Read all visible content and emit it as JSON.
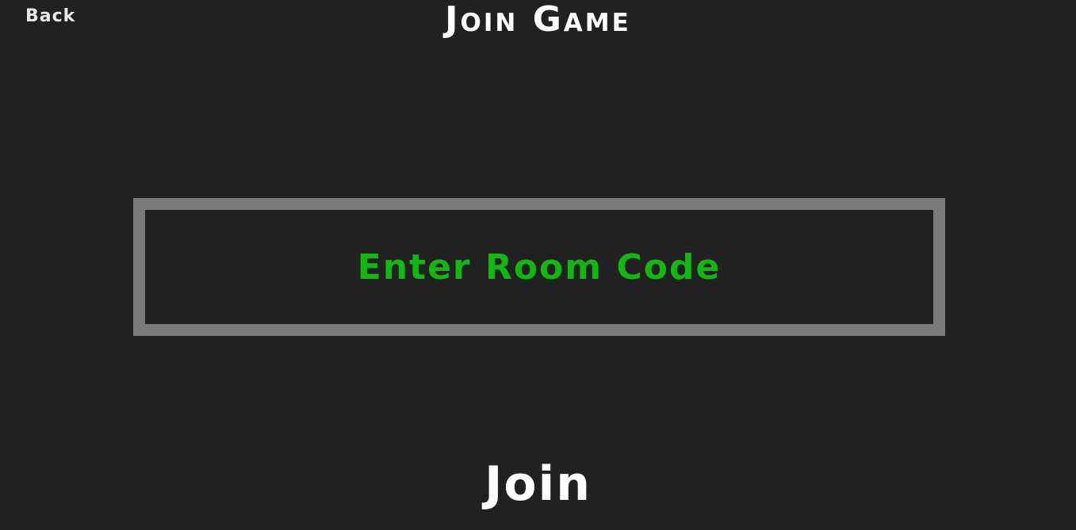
{
  "header": {
    "back_label": "Back",
    "title": "Join Game"
  },
  "room_code": {
    "placeholder": "Enter Room Code",
    "value": ""
  },
  "actions": {
    "join_label": "Join"
  },
  "colors": {
    "background": "#212121",
    "input_border": "#7a7a7a",
    "placeholder_text": "#11b811",
    "primary_text": "#ffffff"
  }
}
